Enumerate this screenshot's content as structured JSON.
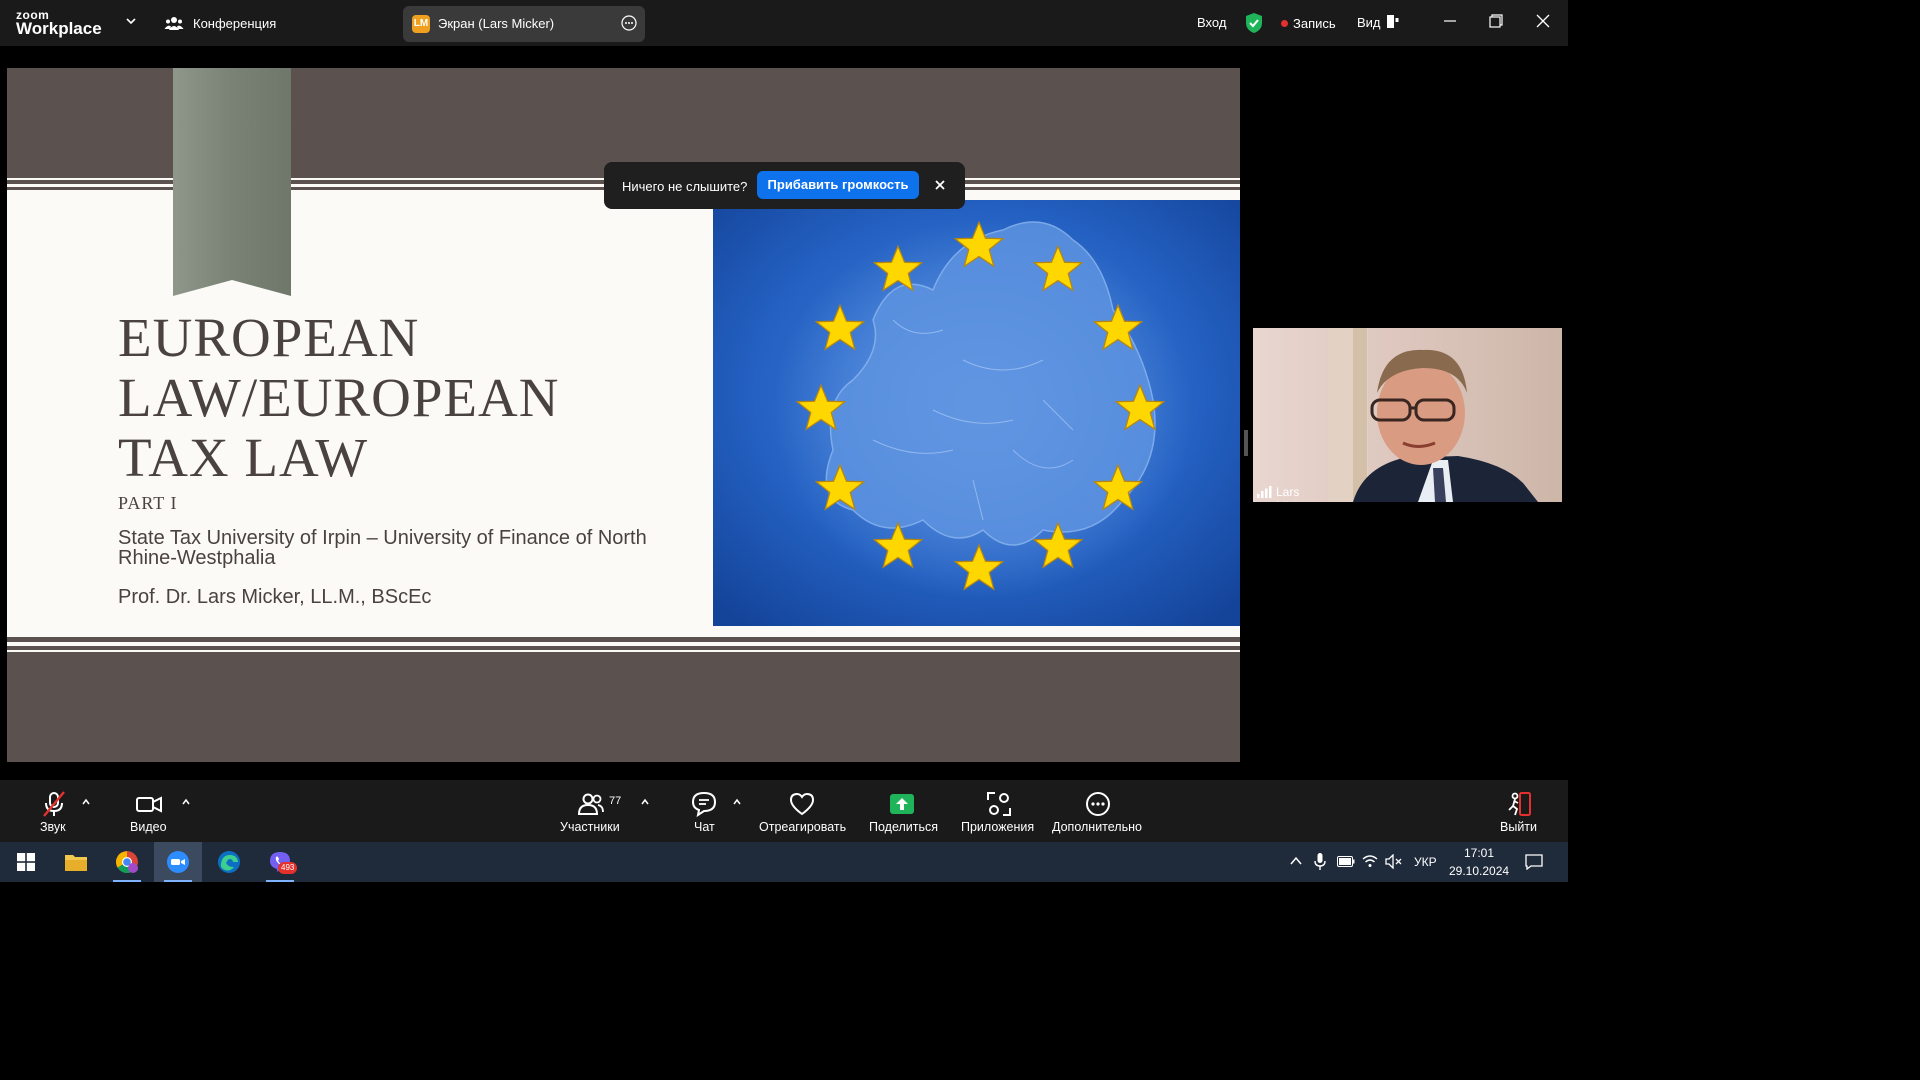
{
  "topbar": {
    "logo_small": "zoom",
    "logo_big": "Workplace",
    "conference_label": "Конференция",
    "screen_badge": "LM",
    "screen_label": "Экран (Lars Micker)",
    "login_label": "Вход",
    "record_label": "Запись",
    "view_label": "Вид",
    "icons": [
      "chevron-down-icon",
      "participants-group-icon",
      "more-icon",
      "shield-check-icon",
      "view-layout-icon",
      "minimize-icon",
      "restore-icon",
      "close-icon"
    ]
  },
  "slide": {
    "title_lines": [
      "EUROPEAN",
      "LAW/EUROPEAN",
      "TAX LAW"
    ],
    "subtitle": "PART I",
    "university": "State Tax University of Irpin –  University of Finance of North Rhine-Westphalia",
    "professor": "Prof.  Dr.  Lars Micker, LL.M., BScEc",
    "colors": {
      "band": "#5b5250",
      "ribbon": "#7c8478",
      "text": "#4a4240",
      "eu_blue": "#1d57b8",
      "star": "#ffd700"
    }
  },
  "notification": {
    "text": "Ничего не слышите?",
    "button": "Прибавить громкость"
  },
  "video": {
    "participant_name": "Lars Micker"
  },
  "toolbar": {
    "audio_label": "Звук",
    "video_label": "Видео",
    "participants_label": "Участники",
    "participants_count": "77",
    "chat_label": "Чат",
    "react_label": "Отреагировать",
    "share_label": "Поделиться",
    "apps_label": "Приложения",
    "more_label": "Дополнительно",
    "leave_label": "Выйти",
    "accent_green": "#1fb35a",
    "mute_red": "#e5312e"
  },
  "taskbar": {
    "viber_badge": "493",
    "language": "УКР",
    "time": "17:01",
    "date": "29.10.2024",
    "apps": [
      "windows-start-icon",
      "file-explorer-icon",
      "chrome-icon",
      "zoom-icon",
      "edge-icon",
      "viber-icon"
    ]
  }
}
